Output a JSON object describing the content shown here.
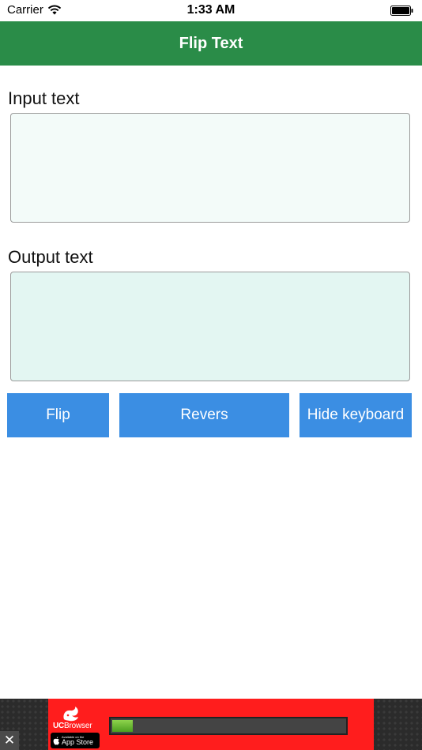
{
  "status_bar": {
    "carrier": "Carrier",
    "time": "1:33 AM",
    "icons": [
      "wifi-icon",
      "battery-icon"
    ]
  },
  "nav": {
    "title": "Flip Text",
    "color": "#2a8c48"
  },
  "input": {
    "label": "Input text",
    "value": "",
    "placeholder": ""
  },
  "output": {
    "label": "Output text",
    "value": ""
  },
  "buttons": {
    "flip": "Flip",
    "revers": "Revers",
    "hide_keyboard": "Hide keyboard",
    "color": "#3b8ee3"
  },
  "ad": {
    "brand_left": "UC",
    "brand_right": "Browser",
    "badge_small": "Available on the",
    "badge_big": "App Store",
    "progress": 0.09,
    "close_glyph": "✕",
    "icons": [
      "uc-squirrel-icon",
      "apple-icon",
      "close-icon"
    ]
  }
}
